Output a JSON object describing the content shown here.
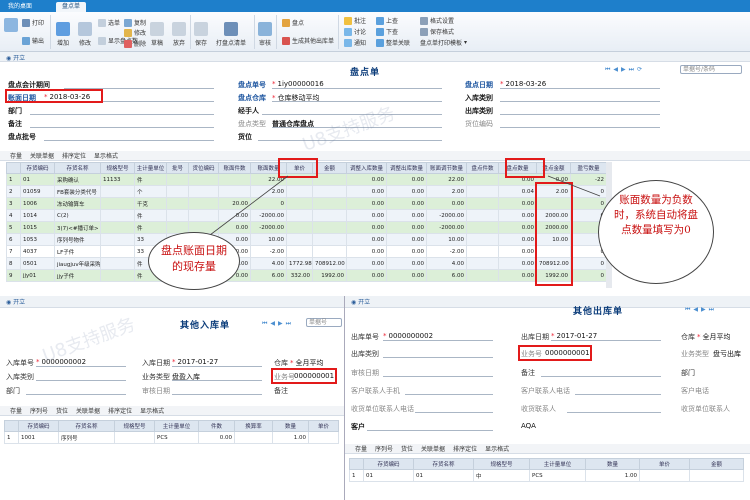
{
  "main": {
    "tabs": [
      "我的桌面",
      "盘点单"
    ],
    "ribbon": {
      "group1": [
        "打印",
        "输出"
      ],
      "group2": [
        "增加",
        "修改",
        "删除",
        "复制",
        "草稿",
        "放弃",
        "保存"
      ],
      "group3": [
        "审核",
        "打盘点清单"
      ],
      "group4": [
        "批注",
        "讨论",
        "通知",
        "上查",
        "下查",
        "整单关联",
        "格式设置",
        "保存格式",
        "盘点单打印模板"
      ],
      "misc": [
        "货位",
        "盘点",
        "格式",
        "选单",
        "显示盘点数",
        "生成其他出库单"
      ]
    },
    "kai": "开立",
    "title": "盘点单",
    "search_placeholder": "单据号/条码",
    "pager": [
      "⏮",
      "◀",
      "▶",
      "⏭",
      "⟳"
    ],
    "header": {
      "pdhjqj_label": "盘点会计期间",
      "zmrq_label": "账面日期",
      "zmrq_value": "2018-03-26",
      "bumen_label": "部门",
      "beizhu_label": "备注",
      "pdph_label": "盘点批号",
      "pddh_label": "盘点单号",
      "pddh_value": "1iy00000016",
      "pdck_label": "盘点仓库",
      "pdck_value": "仓库移动平均",
      "jsr_label": "经手人",
      "pdlx_label": "盘点类型",
      "pdlx_value": "普通仓库盘点",
      "huowei_label": "货位",
      "pdrq_label": "盘点日期",
      "pdrq_value": "2018-03-26",
      "rklb_label": "入库类别",
      "cklb_label": "出库类别",
      "hwbm_label": "货位编码"
    },
    "grid_toolbar": [
      "存量",
      "关联单据",
      "排序定位",
      "显示格式"
    ],
    "columns": [
      "",
      "存货编码",
      "存货名称",
      "规格型号",
      "主计量单位",
      "批号",
      "货位编码",
      "账面件数",
      "账面数量",
      "单价",
      "金额",
      "调整入库数量",
      "调整出库数量",
      "账面调节数量",
      "盘点件数",
      "盘点数量",
      "盘点金额",
      "盈亏数量"
    ],
    "rows": [
      [
        "1",
        "01",
        "采购确认",
        "11133",
        "件",
        "",
        "",
        "",
        "22.00",
        "",
        "",
        "0.00",
        "0.00",
        "22.00",
        "",
        "0.00",
        "0.00",
        "-22"
      ],
      [
        "2",
        "01059",
        "FB套装分类代号",
        "",
        "个",
        "",
        "",
        "",
        "2.00",
        "",
        "",
        "0.00",
        "0.00",
        "2.00",
        "",
        "0.04",
        "2.00",
        "0"
      ],
      [
        "3",
        "1006",
        "冻动输算车",
        "",
        "千克",
        "",
        "",
        "20.00",
        "0",
        "",
        "",
        "0.00",
        "0.00",
        "0.00",
        "",
        "0.00",
        "",
        "0"
      ],
      [
        "4",
        "1014",
        "C(2)",
        "",
        "件",
        "",
        "",
        "0.00",
        "-2000.00",
        "",
        "",
        "0.00",
        "0.00",
        "-2000.00",
        "",
        "0.00",
        "2000.00",
        "0"
      ],
      [
        "5",
        "1015",
        "3(7)<#播订单>",
        "",
        "件",
        "",
        "",
        "0.00",
        "-2000.00",
        "",
        "",
        "0.00",
        "0.00",
        "-2000.00",
        "",
        "0.00",
        "2000.00",
        "0"
      ],
      [
        "6",
        "1053",
        "序列号物件",
        "",
        "33",
        "",
        "",
        "0.00",
        "10.00",
        "",
        "",
        "0.00",
        "0.00",
        "10.00",
        "",
        "0.00",
        "10.00",
        "0"
      ],
      [
        "7",
        "4037",
        "LF子件",
        "",
        "33",
        "",
        "",
        "0.00",
        "-2.00",
        "",
        "",
        "0.00",
        "0.00",
        "-2.00",
        "",
        "0.00",
        "",
        "0"
      ],
      [
        "8",
        "0501",
        "jiaugjuv年级采购",
        "",
        "件",
        "",
        "",
        "0.00",
        "4.00",
        "1772.98",
        "708912.00",
        "0.00",
        "0.00",
        "4.00",
        "",
        "0.00",
        "708912.00",
        "0"
      ],
      [
        "9",
        "jjy01",
        "jjy子件",
        "",
        "件",
        "",
        "",
        "0.00",
        "6.00",
        "332.00",
        "1992.00",
        "0.00",
        "0.00",
        "6.00",
        "",
        "0.00",
        "1992.00",
        "0"
      ]
    ],
    "watermark": "U8支持服务",
    "callout_left": "盘点账面日期的现存量",
    "callout_right": "账面数量为负数时，系统自动将盘点数量填写为0"
  },
  "inbound": {
    "kai": "开立",
    "title": "其他入库单",
    "search_placeholder": "单据号",
    "header": {
      "rkdh_label": "入库单号",
      "rkdh_value": "0000000002",
      "rklb_label": "入库类别",
      "bumen_label": "部门",
      "rkrq_label": "入库日期",
      "rkrq_value": "2017-01-27",
      "ywlx_label": "业务类型",
      "ywlx_value": "盘盈入库",
      "shrq_label": "审核日期",
      "cangku_label": "仓库",
      "cangku_value": "全月平均",
      "ywh_label": "业务号",
      "ywh_value": "000000001",
      "beizhu_label": "备注"
    },
    "grid_toolbar": [
      "存量",
      "序列号",
      "货位",
      "关联单据",
      "排序定位",
      "显示格式"
    ],
    "columns": [
      "",
      "存货编码",
      "存货名称",
      "规格型号",
      "主计量单位",
      "件数",
      "换算率",
      "数量",
      "单价"
    ],
    "rows": [
      [
        "1",
        "1001",
        "序列号",
        "",
        "PCS",
        "0.00",
        "",
        "1.00",
        ""
      ]
    ]
  },
  "outbound": {
    "kai": "开立",
    "title": "其他出库单",
    "header": {
      "ckdh_label": "出库单号",
      "ckdh_value": "0000000002",
      "cklb_label": "出库类别",
      "shrq_label": "审核日期",
      "khlxrsj_label": "客户联系人手机",
      "sflxrdh_label": "收货单位联系人电话",
      "kehu_label": "客户",
      "ckrq_label": "出库日期",
      "ckrq_value": "2017-01-27",
      "ywh_label": "业务号",
      "ywh_value": "0000000001",
      "beizhu_label": "备注",
      "khlxrdh_label": "客户联系人电话",
      "shdz_label": "收货联系人",
      "extra_value": "AQA",
      "cangku_label": "仓库",
      "cangku_value": "全月平均",
      "ywlx_label": "业务类型",
      "ywlx_value": "盘亏出库",
      "bumen_label": "部门",
      "khdh_label": "客户电话",
      "shdw_label": "收货单位联系人"
    },
    "grid_toolbar": [
      "存量",
      "序列号",
      "货位",
      "关联单据",
      "排序定位",
      "显示格式"
    ],
    "columns": [
      "",
      "存货编码",
      "存货名称",
      "规格型号",
      "主计量单位",
      "数量",
      "单价",
      "金额"
    ],
    "rows": [
      [
        "1",
        "01",
        "01",
        "中",
        "PCS",
        "1.00",
        "",
        ""
      ]
    ]
  }
}
